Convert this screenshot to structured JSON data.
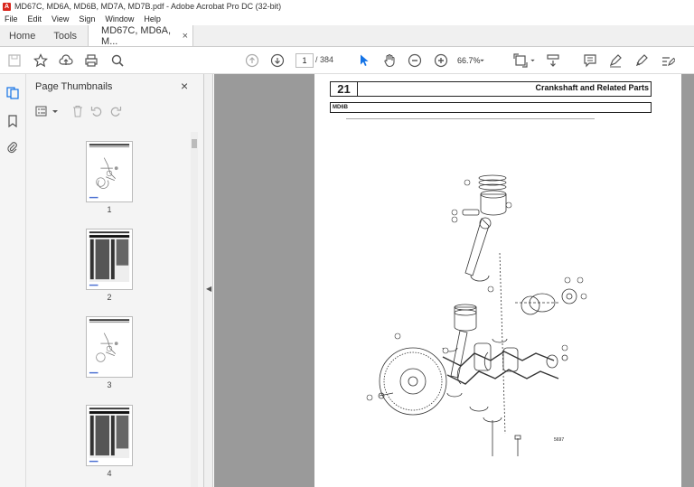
{
  "window": {
    "title": "MD67C, MD6A, MD6B, MD7A, MD7B.pdf - Adobe Acrobat Pro DC (32-bit)"
  },
  "menu": [
    "File",
    "Edit",
    "View",
    "Sign",
    "Window",
    "Help"
  ],
  "tabs": {
    "home": "Home",
    "tools": "Tools",
    "document": "MD67C, MD6A, M...",
    "close": "×"
  },
  "toolbar": {
    "page_current": "1",
    "page_total": "/ 384",
    "zoom": "66.7%"
  },
  "panel": {
    "title": "Page Thumbnails",
    "close": "×"
  },
  "thumbnails": [
    {
      "label": "1",
      "kind": "diagram"
    },
    {
      "label": "2",
      "kind": "table"
    },
    {
      "label": "3",
      "kind": "diagram"
    },
    {
      "label": "4",
      "kind": "table"
    }
  ],
  "document_page": {
    "section_number": "21",
    "section_title": "Crankshaft and Related Parts",
    "model": "MD6B",
    "figure_code": "5697"
  },
  "colors": {
    "accent": "#1473e6",
    "adobe_red": "#d9251c",
    "doc_background": "#9a9a9a"
  }
}
